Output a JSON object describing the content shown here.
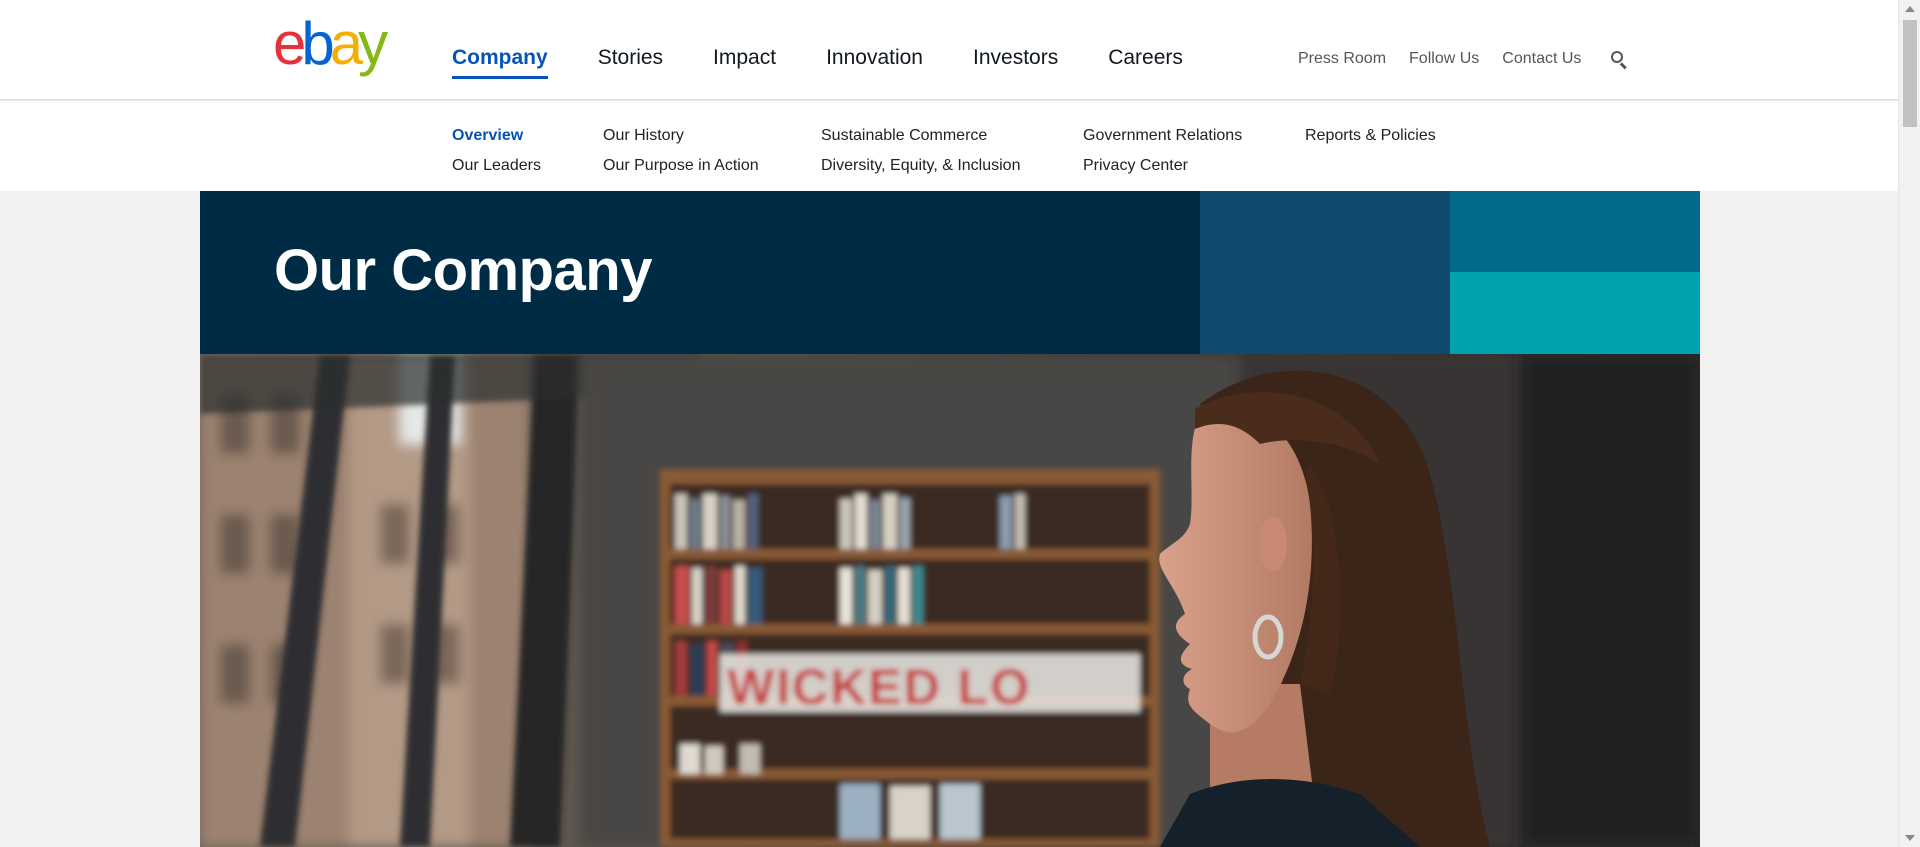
{
  "brand": {
    "letters": [
      {
        "char": "e",
        "color": "#e53238"
      },
      {
        "char": "b",
        "color": "#0064d2"
      },
      {
        "char": "a",
        "color": "#f5af02"
      },
      {
        "char": "y",
        "color": "#86b817"
      }
    ]
  },
  "main_nav": [
    {
      "label": "Company",
      "active": true
    },
    {
      "label": "Stories",
      "active": false
    },
    {
      "label": "Impact",
      "active": false
    },
    {
      "label": "Innovation",
      "active": false
    },
    {
      "label": "Investors",
      "active": false
    },
    {
      "label": "Careers",
      "active": false
    }
  ],
  "utility_nav": {
    "press_room": "Press Room",
    "follow_us": "Follow Us",
    "contact_us": "Contact Us",
    "search_icon": "search-icon"
  },
  "sub_nav": {
    "overview": "Overview",
    "our_leaders": "Our Leaders",
    "our_history": "Our History",
    "our_purpose": "Our Purpose in Action",
    "sustainable_commerce": "Sustainable Commerce",
    "diversity": "Diversity, Equity, & Inclusion",
    "government_relations": "Government Relations",
    "privacy_center": "Privacy Center",
    "reports_policies": "Reports & Policies"
  },
  "hero": {
    "title": "Our Company"
  },
  "photo": {
    "sign_text": "WICKED LO"
  },
  "colors": {
    "accent": "#0654ba",
    "hero_dark": "#002b44",
    "hero_block_1": "#104a6e",
    "hero_block_2": "#026a8b",
    "hero_block_3": "#00a3ad"
  }
}
